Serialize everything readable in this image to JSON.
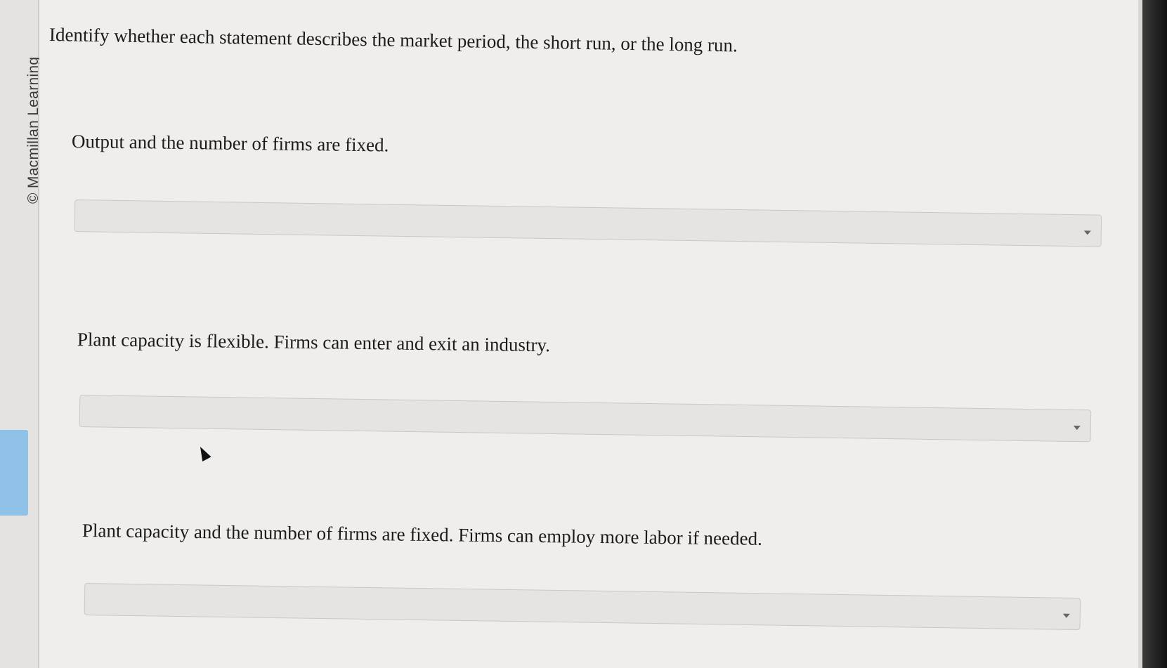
{
  "sidebar": {
    "copyright": "© Macmillan Learning"
  },
  "question": {
    "prompt": "Identify whether each statement describes the market period, the short run, or the long run."
  },
  "items": [
    {
      "statement": "Output and the number of firms are fixed.",
      "selected": "",
      "icon": "chevron-down-icon"
    },
    {
      "statement": "Plant capacity is flexible. Firms can enter and exit an industry.",
      "selected": "",
      "icon": "chevron-down-icon"
    },
    {
      "statement": "Plant capacity and the number of firms are fixed. Firms can employ more labor if needed.",
      "selected": "",
      "icon": "chevron-down-icon"
    }
  ],
  "colors": {
    "rail_tab_accent": "#8fc2e6",
    "page_background": "#efeeec",
    "dropdown_background": "#e5e4e2"
  }
}
